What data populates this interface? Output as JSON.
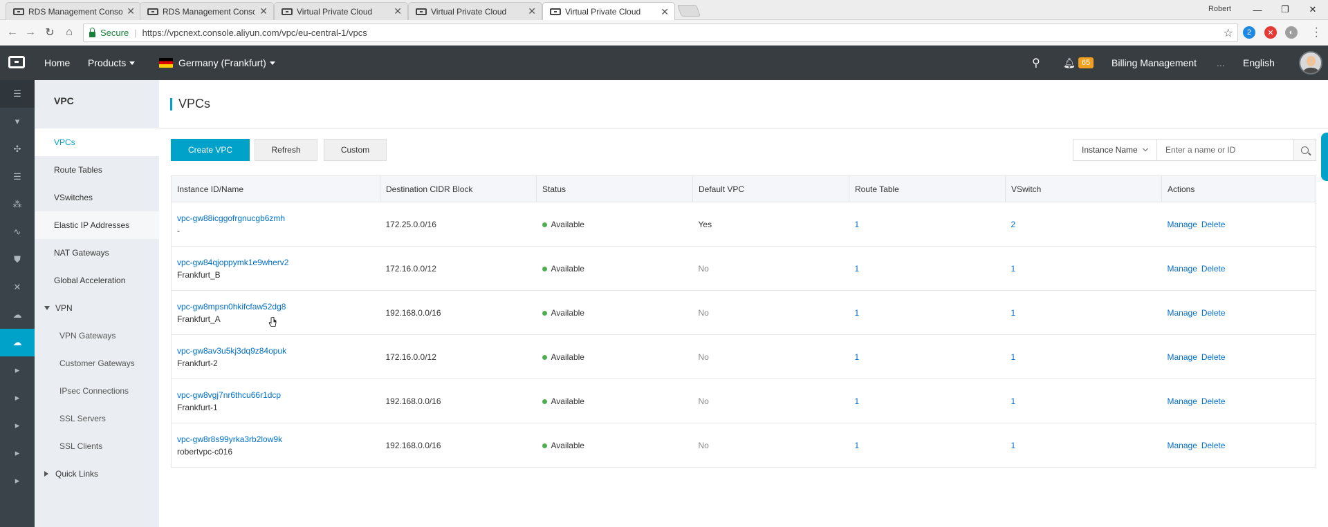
{
  "browser": {
    "tabs": [
      {
        "label": "RDS Management Conso",
        "active": false
      },
      {
        "label": "RDS Management Conso",
        "active": false
      },
      {
        "label": "Virtual Private Cloud",
        "active": false
      },
      {
        "label": "Virtual Private Cloud",
        "active": false
      },
      {
        "label": "Virtual Private Cloud",
        "active": true
      }
    ],
    "user": "Robert",
    "secure_label": "Secure",
    "url": "https://vpcnext.console.aliyun.com/vpc/eu-central-1/vpcs",
    "ext_badge": "2"
  },
  "topnav": {
    "home": "Home",
    "products": "Products",
    "region": "Germany (Frankfurt)",
    "notifications_count": "65",
    "billing": "Billing Management",
    "more": "...",
    "language": "English"
  },
  "sidemenu": {
    "title": "VPC",
    "items": [
      "VPCs",
      "Route Tables",
      "VSwitches",
      "Elastic IP Addresses",
      "NAT Gateways",
      "Global Acceleration"
    ],
    "vpn_group": "VPN",
    "vpn_items": [
      "VPN Gateways",
      "Customer Gateways",
      "IPsec Connections",
      "SSL Servers",
      "SSL Clients"
    ],
    "quick_links": "Quick Links"
  },
  "page": {
    "title": "VPCs",
    "create_button": "Create VPC",
    "refresh_button": "Refresh",
    "custom_button": "Custom",
    "filter_label": "Instance Name",
    "search_placeholder": "Enter a name or ID"
  },
  "table": {
    "columns": [
      "Instance ID/Name",
      "Destination CIDR Block",
      "Status",
      "Default VPC",
      "Route Table",
      "VSwitch",
      "Actions"
    ],
    "manage_label": "Manage",
    "delete_label": "Delete",
    "rows": [
      {
        "id": "vpc-gw88icggofrgnucgb6zmh",
        "name": "-",
        "cidr": "172.25.0.0/16",
        "status": "Available",
        "default": "Yes",
        "route_table": "1",
        "vswitch": "2"
      },
      {
        "id": "vpc-gw84qjoppymk1e9wherv2",
        "name": "Frankfurt_B",
        "cidr": "172.16.0.0/12",
        "status": "Available",
        "default": "No",
        "route_table": "1",
        "vswitch": "1"
      },
      {
        "id": "vpc-gw8mpsn0hkifcfaw52dg8",
        "name": "Frankfurt_A",
        "cidr": "192.168.0.0/16",
        "status": "Available",
        "default": "No",
        "route_table": "1",
        "vswitch": "1"
      },
      {
        "id": "vpc-gw8av3u5kj3dq9z84opuk",
        "name": "Frankfurt-2",
        "cidr": "172.16.0.0/12",
        "status": "Available",
        "default": "No",
        "route_table": "1",
        "vswitch": "1"
      },
      {
        "id": "vpc-gw8vgj7nr6thcu66r1dcp",
        "name": "Frankfurt-1",
        "cidr": "192.168.0.0/16",
        "status": "Available",
        "default": "No",
        "route_table": "1",
        "vswitch": "1"
      },
      {
        "id": "vpc-gw8r8s99yrka3rb2low9k",
        "name": "robertvpc-c016",
        "cidr": "192.168.0.0/16",
        "status": "Available",
        "default": "No",
        "route_table": "1",
        "vswitch": "1"
      }
    ]
  },
  "colors": {
    "accent": "#00a2ca",
    "topnav": "#373d41",
    "link": "#0070cc",
    "status_ok": "#4caf50",
    "badge": "#f0a01e"
  }
}
